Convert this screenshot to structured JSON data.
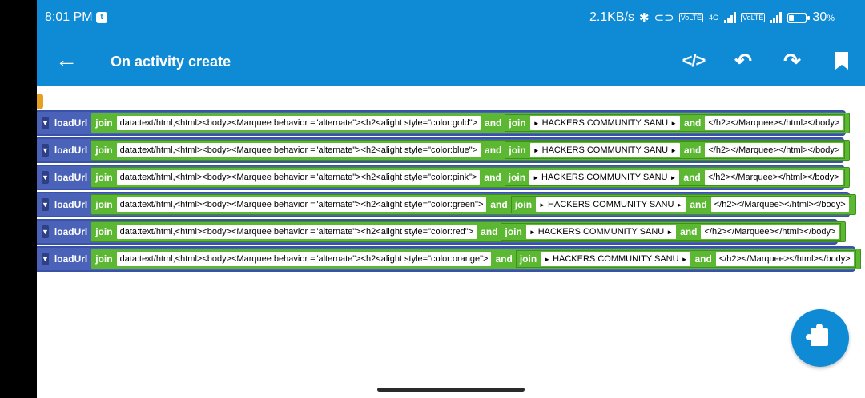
{
  "status_bar": {
    "time": "8:01 PM",
    "notification_icon": "twitter-icon",
    "network_speed": "2.1KB/s",
    "sim_tag": "VoLTE",
    "network_type": "4G",
    "battery_percent": "30",
    "battery_unit": "%",
    "battery_level": 0.3
  },
  "app_bar": {
    "title": "On activity create",
    "icons": [
      "back-arrow-icon",
      "code-icon",
      "undo-icon",
      "redo-icon",
      "bookmark-icon"
    ]
  },
  "blocks": [
    {
      "method": "loadUrl",
      "join": "join",
      "text1": "data:text/html,<html><body><Marquee behavior =\"alternate\"><h2<alight style=\"color:gold\">",
      "and": "and",
      "join2": "join",
      "text2": "HACKERS COMMUNITY SANU",
      "and2": "and",
      "text3": "</h2></Marquee></html></body>"
    },
    {
      "method": "loadUrl",
      "join": "join",
      "text1": "data:text/html,<html><body><Marquee behavior =\"alternate\"><h2<alight style=\"color:blue\">",
      "and": "and",
      "join2": "join",
      "text2": "HACKERS COMMUNITY SANU",
      "and2": "and",
      "text3": "</h2></Marquee></html></body>"
    },
    {
      "method": "loadUrl",
      "join": "join",
      "text1": "data:text/html,<html><body><Marquee behavior =\"alternate\"><h2<alight style=\"color:pink\">",
      "and": "and",
      "join2": "join",
      "text2": "HACKERS COMMUNITY SANU",
      "and2": "and",
      "text3": "</h2></Marquee></html></body>"
    },
    {
      "method": "loadUrl",
      "join": "join",
      "text1": "data:text/html,<html><body><Marquee behavior =\"alternate\"><h2<alight style=\"color:green\">",
      "and": "and",
      "join2": "join",
      "text2": "HACKERS COMMUNITY SANU",
      "and2": "and",
      "text3": "</h2></Marquee></html></body>"
    },
    {
      "method": "loadUrl",
      "join": "join",
      "text1": "data:text/html,<html><body><Marquee behavior =\"alternate\"><h2<alight style=\"color:red\">",
      "and": "and",
      "join2": "join",
      "text2": "HACKERS COMMUNITY SANU",
      "and2": "and",
      "text3": "</h2></Marquee></html></body>"
    },
    {
      "method": "loadUrl",
      "join": "join",
      "text1": "data:text/html,<html><body><Marquee behavior =\"alternate\"><h2<alight style=\"color:orange\">",
      "and": "and",
      "join2": "join",
      "text2": "HACKERS COMMUNITY SANU",
      "and2": "and",
      "text3": "</h2></Marquee></html></body>"
    }
  ],
  "colors": {
    "primary": "#0f8bd6",
    "method_block": "#4a63b8",
    "text_block": "#5cb832",
    "event_block": "#e6a021"
  },
  "fab_icon": "puzzle-piece-icon"
}
